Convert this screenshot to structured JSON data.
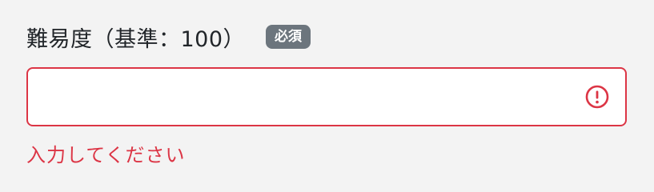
{
  "field": {
    "label": "難易度（基準：100）",
    "required_badge": "必須",
    "input_value": "",
    "error_message": "入力してください",
    "error_icon": "exclamation-circle-icon"
  },
  "colors": {
    "background": "#f3f3f3",
    "error": "#dc3545",
    "badge_bg": "#6c757d",
    "text": "#212529"
  }
}
